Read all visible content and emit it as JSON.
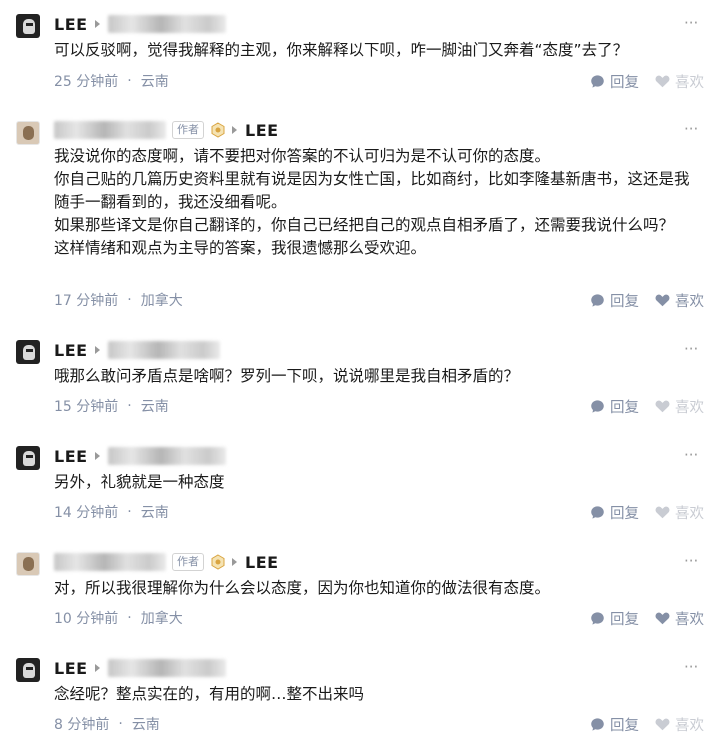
{
  "actions": {
    "reply": "回复",
    "like": "喜欢"
  },
  "comments": [
    {
      "author": "LEE",
      "text": [
        "可以反驳啊，觉得我解释的主观，你来解释以下呗，咋一脚油门又奔着“态度”去了？"
      ],
      "time": "25 分钟前",
      "location": "云南"
    },
    {
      "author_tag": "作者",
      "reply_to": "LEE",
      "text": [
        "我没说你的态度啊，请不要把对你答案的不认可归为是不认可你的态度。",
        "你自己贴的几篇历史资料里就有说是因为女性亡国，比如商纣，比如李隆基新唐书，这还是我随手一翻看到的，我还没细看呢。",
        "如果那些译文是你自己翻译的，你自己已经把自己的观点自相矛盾了，还需要我说什么吗？",
        "这样情绪和观点为主导的答案，我很遗憾那么受欢迎。"
      ],
      "time": "17 分钟前",
      "location": "加拿大"
    },
    {
      "author": "LEE",
      "text": [
        "哦那么敢问矛盾点是啥啊？罗列一下呗，说说哪里是我自相矛盾的？"
      ],
      "time": "15 分钟前",
      "location": "云南"
    },
    {
      "author": "LEE",
      "text": [
        "另外，礼貌就是一种态度"
      ],
      "time": "14 分钟前",
      "location": "云南"
    },
    {
      "author_tag": "作者",
      "reply_to": "LEE",
      "text": [
        "对，所以我很理解你为什么会以态度，因为你也知道你的做法很有态度。"
      ],
      "time": "10 分钟前",
      "location": "加拿大"
    },
    {
      "author": "LEE",
      "text": [
        "念经呢？整点实在的，有用的啊…整不出来吗"
      ],
      "time": "8 分钟前",
      "location": "云南"
    }
  ],
  "colors": {
    "meta": "#8590a6",
    "text": "#1a1a1a",
    "like_active": "#8590a6",
    "like_inactive": "#c9ccd3"
  }
}
